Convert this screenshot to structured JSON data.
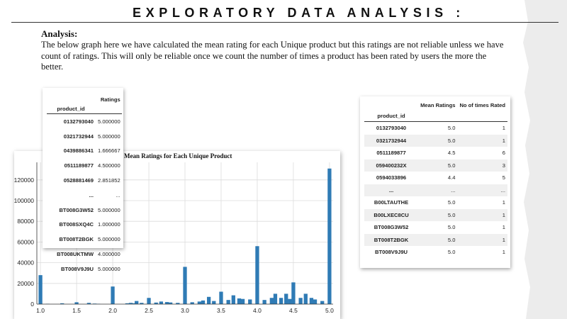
{
  "slide": {
    "title": "EXPLORATORY DATA ANALYSIS :",
    "analysis_heading": "Analysis:",
    "analysis_text": "The below graph here we have calculated the mean rating for each Unique product but this ratings are not reliable unless we have count of ratings. This will only be reliable once we count the number of times a product  has been rated by users the more the better."
  },
  "left_table": {
    "column_header": "Ratings",
    "index_name": "product_id",
    "rows": [
      {
        "id": "0132793040",
        "value": "5.000000"
      },
      {
        "id": "0321732944",
        "value": "5.000000"
      },
      {
        "id": "0439886341",
        "value": "1.666667"
      },
      {
        "id": "0511189877",
        "value": "4.500000"
      },
      {
        "id": "0528881469",
        "value": "2.851852"
      },
      {
        "id": "...",
        "value": "..."
      },
      {
        "id": "BT008G3W52",
        "value": "5.000000"
      },
      {
        "id": "BT008SXQ4C",
        "value": "1.000000"
      },
      {
        "id": "BT008T2BGK",
        "value": "5.000000"
      },
      {
        "id": "BT008UKTMW",
        "value": "4.000000"
      },
      {
        "id": "BT008V9J9U",
        "value": "5.000000"
      }
    ]
  },
  "right_table": {
    "col_mean": "Mean Ratings",
    "col_count": "No of times Rated",
    "index_name": "product_id",
    "rows": [
      {
        "id": "0132793040",
        "mean": "5.0",
        "count": "1"
      },
      {
        "id": "0321732944",
        "mean": "5.0",
        "count": "1"
      },
      {
        "id": "0511189877",
        "mean": "4.5",
        "count": "6"
      },
      {
        "id": "059400232X",
        "mean": "5.0",
        "count": "3"
      },
      {
        "id": "0594033896",
        "mean": "4.4",
        "count": "5"
      },
      {
        "id": "...",
        "mean": "...",
        "count": "..."
      },
      {
        "id": "B00LTAUTHE",
        "mean": "5.0",
        "count": "1"
      },
      {
        "id": "B00LXEC8CU",
        "mean": "5.0",
        "count": "1"
      },
      {
        "id": "BT008G3W52",
        "mean": "5.0",
        "count": "1"
      },
      {
        "id": "BT008T2BGK",
        "mean": "5.0",
        "count": "1"
      },
      {
        "id": "BT008V9J9U",
        "mean": "5.0",
        "count": "1"
      }
    ]
  },
  "chart_data": {
    "type": "bar",
    "title": "Mean Ratings for Each Unique Product",
    "xlabel": "",
    "ylabel": "",
    "xlim": [
      0.95,
      5.05
    ],
    "ylim": [
      0,
      137000
    ],
    "x_ticks": [
      "1.0",
      "1.5",
      "2.0",
      "2.5",
      "3.0",
      "3.5",
      "4.0",
      "4.5",
      "5.0"
    ],
    "y_ticks": [
      "0",
      "20000",
      "40000",
      "60000",
      "80000",
      "100000",
      "120000"
    ],
    "grid": true,
    "bar_color": "#2f7bb5",
    "bins": [
      {
        "x": 1.0,
        "count": 28000
      },
      {
        "x": 1.1,
        "count": 300
      },
      {
        "x": 1.3,
        "count": 800
      },
      {
        "x": 1.5,
        "count": 1800
      },
      {
        "x": 1.67,
        "count": 1200
      },
      {
        "x": 1.75,
        "count": 500
      },
      {
        "x": 1.8,
        "count": 300
      },
      {
        "x": 2.0,
        "count": 17000
      },
      {
        "x": 2.2,
        "count": 800
      },
      {
        "x": 2.25,
        "count": 1200
      },
      {
        "x": 2.3,
        "count": 800
      },
      {
        "x": 2.33,
        "count": 3000
      },
      {
        "x": 2.4,
        "count": 1200
      },
      {
        "x": 2.5,
        "count": 6000
      },
      {
        "x": 2.6,
        "count": 1500
      },
      {
        "x": 2.67,
        "count": 2500
      },
      {
        "x": 2.75,
        "count": 2000
      },
      {
        "x": 2.8,
        "count": 1600
      },
      {
        "x": 2.9,
        "count": 1200
      },
      {
        "x": 3.0,
        "count": 36000
      },
      {
        "x": 3.1,
        "count": 1800
      },
      {
        "x": 3.2,
        "count": 2500
      },
      {
        "x": 3.25,
        "count": 3500
      },
      {
        "x": 3.33,
        "count": 7000
      },
      {
        "x": 3.4,
        "count": 3000
      },
      {
        "x": 3.5,
        "count": 12000
      },
      {
        "x": 3.6,
        "count": 4000
      },
      {
        "x": 3.67,
        "count": 8500
      },
      {
        "x": 3.75,
        "count": 5500
      },
      {
        "x": 3.8,
        "count": 5000
      },
      {
        "x": 3.9,
        "count": 4500
      },
      {
        "x": 4.0,
        "count": 56000
      },
      {
        "x": 4.1,
        "count": 4000
      },
      {
        "x": 4.2,
        "count": 6000
      },
      {
        "x": 4.25,
        "count": 10000
      },
      {
        "x": 4.33,
        "count": 6000
      },
      {
        "x": 4.4,
        "count": 10000
      },
      {
        "x": 4.45,
        "count": 5000
      },
      {
        "x": 4.5,
        "count": 21000
      },
      {
        "x": 4.6,
        "count": 6000
      },
      {
        "x": 4.67,
        "count": 10000
      },
      {
        "x": 4.75,
        "count": 6000
      },
      {
        "x": 4.8,
        "count": 4500
      },
      {
        "x": 4.9,
        "count": 3000
      },
      {
        "x": 5.0,
        "count": 131000
      }
    ]
  }
}
